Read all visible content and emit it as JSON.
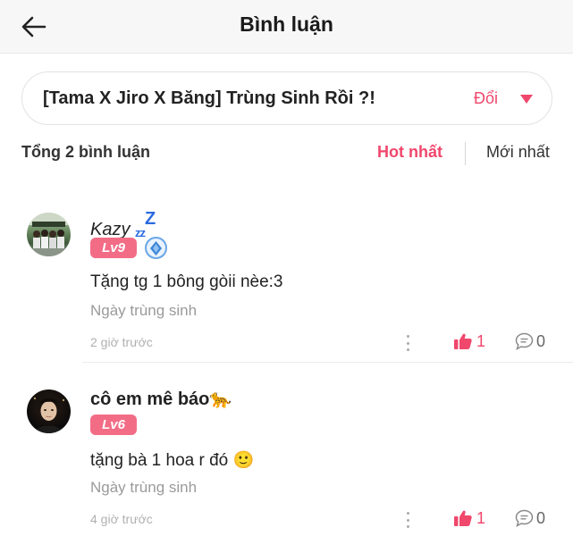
{
  "header": {
    "title": "Bình luận",
    "back_icon": "arrow-left-icon"
  },
  "story": {
    "title": "[Tama X Jiro X Băng] Trùng Sinh Rồi ?!",
    "change_label": "Đổi",
    "caret_icon": "caret-down-icon"
  },
  "summary": {
    "total_label": "Tổng 2 bình luận",
    "sort_options": [
      "Hot nhất",
      "Mới nhất"
    ],
    "active_sort": "Hot nhất"
  },
  "colors": {
    "accent": "#f0476c",
    "level_badge": "#f36c86",
    "muted": "#9a9a9a"
  },
  "comments": [
    {
      "user": "Kazy",
      "user_suffix": "zzZ",
      "level": "Lv9",
      "rank_icon": "rank-badge-icon",
      "text": "Tặng tg 1 bông gòii nèe:3",
      "chapter": "Ngày trùng sinh",
      "time": "2 giờ trước",
      "likes": "1",
      "replies": "0"
    },
    {
      "user": "cô em mê báo",
      "user_emoji": "🐆",
      "level": "Lv6",
      "text": "tặng bà 1 hoa r đó",
      "text_emoji": "🙂",
      "chapter": "Ngày trùng sinh",
      "time": "4 giờ trước",
      "likes": "1",
      "replies": "0"
    }
  ]
}
